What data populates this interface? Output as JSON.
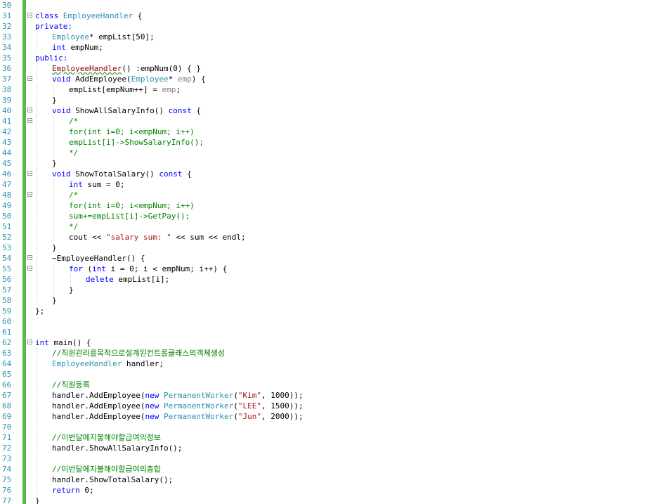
{
  "editor": {
    "colors": {
      "background": "#ffffff",
      "line_number": "#2b91af",
      "change_bar": "#57b94a",
      "keyword": "#0000ff",
      "type": "#2b91af",
      "comment": "#008000",
      "string": "#a31515"
    },
    "fold_icon": "minus-box-icon",
    "lines": [
      {
        "n": "30",
        "ind": 0,
        "fold": false,
        "seg": []
      },
      {
        "n": "31",
        "ind": 0,
        "fold": true,
        "seg": [
          {
            "t": "class ",
            "c": "kw"
          },
          {
            "t": "EmployeeHandler",
            "c": "ty"
          },
          {
            "t": " {",
            "c": ""
          }
        ]
      },
      {
        "n": "32",
        "ind": 0,
        "fold": false,
        "seg": [
          {
            "t": "private:",
            "c": "kw"
          }
        ]
      },
      {
        "n": "33",
        "ind": 1,
        "fold": false,
        "seg": [
          {
            "t": "Employee",
            "c": "ty"
          },
          {
            "t": "* empList[50];",
            "c": ""
          }
        ]
      },
      {
        "n": "34",
        "ind": 1,
        "fold": false,
        "seg": [
          {
            "t": "int",
            "c": "kw"
          },
          {
            "t": " empNum;",
            "c": ""
          }
        ]
      },
      {
        "n": "35",
        "ind": 0,
        "fold": false,
        "seg": [
          {
            "t": "public:",
            "c": "kw"
          }
        ]
      },
      {
        "n": "36",
        "ind": 1,
        "fold": false,
        "seg": [
          {
            "t": "EmployeeHandler",
            "c": "fn squig"
          },
          {
            "t": "() :empNum(0) { }",
            "c": ""
          }
        ]
      },
      {
        "n": "37",
        "ind": 1,
        "fold": true,
        "seg": [
          {
            "t": "void",
            "c": "kw"
          },
          {
            "t": " AddEmployee(",
            "c": ""
          },
          {
            "t": "Employee",
            "c": "ty"
          },
          {
            "t": "* ",
            "c": ""
          },
          {
            "t": "emp",
            "c": "pm"
          },
          {
            "t": ") {",
            "c": ""
          }
        ]
      },
      {
        "n": "38",
        "ind": 2,
        "fold": false,
        "seg": [
          {
            "t": "empList[empNum++] = ",
            "c": ""
          },
          {
            "t": "emp",
            "c": "pm"
          },
          {
            "t": ";",
            "c": ""
          }
        ]
      },
      {
        "n": "39",
        "ind": 1,
        "fold": false,
        "seg": [
          {
            "t": "}",
            "c": ""
          }
        ]
      },
      {
        "n": "40",
        "ind": 1,
        "fold": true,
        "seg": [
          {
            "t": "void",
            "c": "kw"
          },
          {
            "t": " ShowAllSalaryInfo() ",
            "c": ""
          },
          {
            "t": "const",
            "c": "kw"
          },
          {
            "t": " {",
            "c": ""
          }
        ]
      },
      {
        "n": "41",
        "ind": 2,
        "fold": true,
        "seg": [
          {
            "t": "/*",
            "c": "cm"
          }
        ]
      },
      {
        "n": "42",
        "ind": 2,
        "fold": false,
        "seg": [
          {
            "t": "for(int i=0; i<empNum; i++)",
            "c": "cm"
          }
        ]
      },
      {
        "n": "43",
        "ind": 2,
        "fold": false,
        "seg": [
          {
            "t": "empList[i]->ShowSalaryInfo();",
            "c": "cm"
          }
        ]
      },
      {
        "n": "44",
        "ind": 2,
        "fold": false,
        "seg": [
          {
            "t": "*/",
            "c": "cm"
          }
        ]
      },
      {
        "n": "45",
        "ind": 1,
        "fold": false,
        "seg": [
          {
            "t": "}",
            "c": ""
          }
        ]
      },
      {
        "n": "46",
        "ind": 1,
        "fold": true,
        "seg": [
          {
            "t": "void",
            "c": "kw"
          },
          {
            "t": " ShowTotalSalary() ",
            "c": ""
          },
          {
            "t": "const",
            "c": "kw"
          },
          {
            "t": " {",
            "c": ""
          }
        ]
      },
      {
        "n": "47",
        "ind": 2,
        "fold": false,
        "seg": [
          {
            "t": "int",
            "c": "kw"
          },
          {
            "t": " sum = 0;",
            "c": ""
          }
        ]
      },
      {
        "n": "48",
        "ind": 2,
        "fold": true,
        "seg": [
          {
            "t": "/*",
            "c": "cm"
          }
        ]
      },
      {
        "n": "49",
        "ind": 2,
        "fold": false,
        "seg": [
          {
            "t": "for(int i=0; i<empNum; i++)",
            "c": "cm"
          }
        ]
      },
      {
        "n": "50",
        "ind": 2,
        "fold": false,
        "seg": [
          {
            "t": "sum+=empList[i]->GetPay();",
            "c": "cm"
          }
        ]
      },
      {
        "n": "51",
        "ind": 2,
        "fold": false,
        "seg": [
          {
            "t": "*/",
            "c": "cm"
          }
        ]
      },
      {
        "n": "52",
        "ind": 2,
        "fold": false,
        "seg": [
          {
            "t": "cout << ",
            "c": ""
          },
          {
            "t": "\"salary sum: \"",
            "c": "st"
          },
          {
            "t": " << sum << endl;",
            "c": ""
          }
        ]
      },
      {
        "n": "53",
        "ind": 1,
        "fold": false,
        "seg": [
          {
            "t": "}",
            "c": ""
          }
        ]
      },
      {
        "n": "54",
        "ind": 1,
        "fold": true,
        "seg": [
          {
            "t": "~EmployeeHandler() {",
            "c": ""
          }
        ]
      },
      {
        "n": "55",
        "ind": 2,
        "fold": true,
        "seg": [
          {
            "t": "for",
            "c": "kw"
          },
          {
            "t": " (",
            "c": ""
          },
          {
            "t": "int",
            "c": "kw"
          },
          {
            "t": " i = 0; i < empNum; i++) {",
            "c": ""
          }
        ]
      },
      {
        "n": "56",
        "ind": 3,
        "fold": false,
        "seg": [
          {
            "t": "delete",
            "c": "kw"
          },
          {
            "t": " empList[i];",
            "c": ""
          }
        ]
      },
      {
        "n": "57",
        "ind": 2,
        "fold": false,
        "seg": [
          {
            "t": "}",
            "c": ""
          }
        ]
      },
      {
        "n": "58",
        "ind": 1,
        "fold": false,
        "seg": [
          {
            "t": "}",
            "c": ""
          }
        ]
      },
      {
        "n": "59",
        "ind": 0,
        "fold": false,
        "seg": [
          {
            "t": "};",
            "c": ""
          }
        ]
      },
      {
        "n": "60",
        "ind": 0,
        "fold": false,
        "seg": []
      },
      {
        "n": "61",
        "ind": 0,
        "fold": false,
        "seg": []
      },
      {
        "n": "62",
        "ind": 0,
        "fold": true,
        "seg": [
          {
            "t": "int",
            "c": "kw"
          },
          {
            "t": " main() {",
            "c": ""
          }
        ]
      },
      {
        "n": "63",
        "ind": 1,
        "fold": false,
        "seg": [
          {
            "t": "//직원관리를목적으로설계된컨트롤클래스의객체생성",
            "c": "cm"
          }
        ]
      },
      {
        "n": "64",
        "ind": 1,
        "fold": false,
        "seg": [
          {
            "t": "EmployeeHandler",
            "c": "ty"
          },
          {
            "t": " handler;",
            "c": ""
          }
        ]
      },
      {
        "n": "65",
        "ind": 1,
        "fold": false,
        "seg": []
      },
      {
        "n": "66",
        "ind": 1,
        "fold": false,
        "seg": [
          {
            "t": "//직원등록",
            "c": "cm"
          }
        ]
      },
      {
        "n": "67",
        "ind": 1,
        "fold": false,
        "seg": [
          {
            "t": "handler.AddEmployee(",
            "c": ""
          },
          {
            "t": "new",
            "c": "kw"
          },
          {
            "t": " ",
            "c": ""
          },
          {
            "t": "PermanentWorker",
            "c": "ty"
          },
          {
            "t": "(",
            "c": ""
          },
          {
            "t": "\"Kim\"",
            "c": "st"
          },
          {
            "t": ", 1000));",
            "c": ""
          }
        ]
      },
      {
        "n": "68",
        "ind": 1,
        "fold": false,
        "seg": [
          {
            "t": "handler.AddEmployee(",
            "c": ""
          },
          {
            "t": "new",
            "c": "kw"
          },
          {
            "t": " ",
            "c": ""
          },
          {
            "t": "PermanentWorker",
            "c": "ty"
          },
          {
            "t": "(",
            "c": ""
          },
          {
            "t": "\"LEE\"",
            "c": "st"
          },
          {
            "t": ", 1500));",
            "c": ""
          }
        ]
      },
      {
        "n": "69",
        "ind": 1,
        "fold": false,
        "seg": [
          {
            "t": "handler.AddEmployee(",
            "c": ""
          },
          {
            "t": "new",
            "c": "kw"
          },
          {
            "t": " ",
            "c": ""
          },
          {
            "t": "PermanentWorker",
            "c": "ty"
          },
          {
            "t": "(",
            "c": ""
          },
          {
            "t": "\"Jun\"",
            "c": "st"
          },
          {
            "t": ", 2000));",
            "c": ""
          }
        ]
      },
      {
        "n": "70",
        "ind": 1,
        "fold": false,
        "seg": []
      },
      {
        "n": "71",
        "ind": 1,
        "fold": false,
        "seg": [
          {
            "t": "//이번달에지불해야할급여의정보",
            "c": "cm"
          }
        ]
      },
      {
        "n": "72",
        "ind": 1,
        "fold": false,
        "seg": [
          {
            "t": "handler.ShowAllSalaryInfo();",
            "c": ""
          }
        ]
      },
      {
        "n": "73",
        "ind": 1,
        "fold": false,
        "seg": []
      },
      {
        "n": "74",
        "ind": 1,
        "fold": false,
        "seg": [
          {
            "t": "//이번달에지불해야할급여의총합",
            "c": "cm"
          }
        ]
      },
      {
        "n": "75",
        "ind": 1,
        "fold": false,
        "seg": [
          {
            "t": "handler.ShowTotalSalary();",
            "c": ""
          }
        ]
      },
      {
        "n": "76",
        "ind": 1,
        "fold": false,
        "seg": [
          {
            "t": "return",
            "c": "kw"
          },
          {
            "t": " 0;",
            "c": ""
          }
        ]
      },
      {
        "n": "77",
        "ind": 0,
        "fold": false,
        "seg": [
          {
            "t": "}",
            "c": ""
          }
        ]
      }
    ]
  }
}
